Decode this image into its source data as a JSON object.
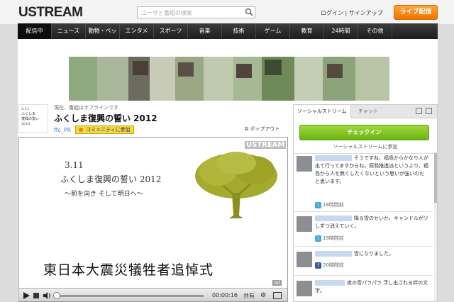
{
  "header": {
    "logo": "USTREAM",
    "search_placeholder": "ユーザと番組の検索",
    "login": "ログイン | サインアップ",
    "live_button": "ライブ配信"
  },
  "nav": [
    "配信中",
    "ニュース",
    "動物・ペット",
    "エンタメ",
    "スポーツ",
    "音楽",
    "技術",
    "ゲーム",
    "教育",
    "24時間",
    "その他"
  ],
  "channel": {
    "thumb_lines": [
      "3.11",
      "ふくしま",
      "復興の誓い",
      "2012"
    ],
    "status": "現在、番組はオフラインです",
    "title": "ふくしま復興の誓い 2012",
    "owner": "ffc_PR",
    "join_button": "コミュニティに参加",
    "popout": "ポップアウト"
  },
  "video": {
    "watermark": "USTREAM",
    "date": "3.11",
    "title": "ふくしま復興の誓い 2012",
    "subtitle": "～前を向き そして明日へ～",
    "banner": "東日本大震災犠牲者追悼式",
    "time": "00:00:16",
    "share": "共有",
    "ad": "Ad"
  },
  "sidebar": {
    "tabs": [
      "ソーシャルストリーム",
      "チャット"
    ],
    "checkin": "チェックイン",
    "join_social": "ソーシャルストリームに参加",
    "posts": [
      {
        "text": "そうですね、福島からかなり人が出て行ってますからね。原発推進派というより、福島から人を無くしたくないという思いが強いのだと思います。",
        "time": "18時間前",
        "source": "twitter"
      },
      {
        "text": "降る雪のせいか、キャンドルが少しずつ消えていく。",
        "time": "19時間前",
        "source": "twitter"
      },
      {
        "text": "雪になりました。",
        "time": "20時間前",
        "source": "facebook"
      },
      {
        "text": "夜の雪パラパラ 浮し出される絆の文字。",
        "time": "",
        "source": "twitter"
      }
    ]
  }
}
